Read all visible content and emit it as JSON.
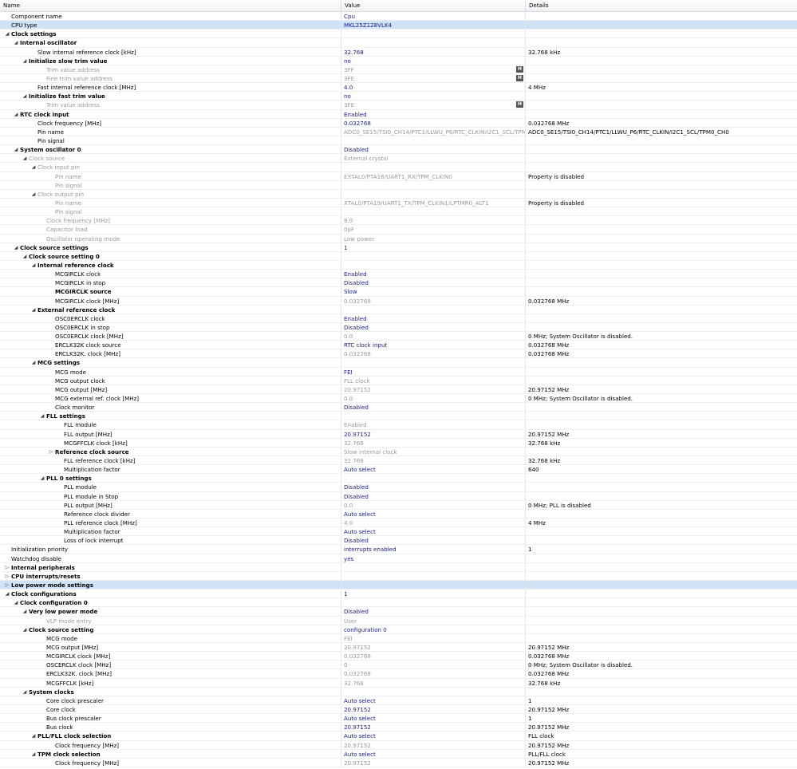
{
  "columns": {
    "name": "Name",
    "value": "Value",
    "details": "Details"
  },
  "rows": [
    {
      "name": "Component name",
      "value": "Cpu",
      "details": "",
      "indent": 0,
      "exp": "",
      "bold": false,
      "grey": false,
      "vgrey": false
    },
    {
      "name": "CPU type",
      "value": "MKL25Z128VLK4",
      "details": "",
      "indent": 0,
      "exp": "",
      "bold": false,
      "grey": false,
      "vgrey": false,
      "sel": true
    },
    {
      "name": "Clock settings",
      "value": "",
      "details": "",
      "indent": 0,
      "exp": "◢",
      "bold": true
    },
    {
      "name": "Internal oscillator",
      "value": "",
      "details": "",
      "indent": 1,
      "exp": "◢",
      "bold": true
    },
    {
      "name": "Slow internal reference clock [kHz]",
      "value": "32.768",
      "details": "32.768 kHz",
      "indent": 3
    },
    {
      "name": "Initialize slow trim value",
      "value": "no",
      "details": "",
      "indent": 2,
      "exp": "◢",
      "bold": true
    },
    {
      "name": "Trim value address",
      "value": "3FF",
      "details": "",
      "indent": 4,
      "grey": true,
      "vgrey": true,
      "h": true
    },
    {
      "name": "Fine trim value address",
      "value": "3FE",
      "details": "",
      "indent": 4,
      "grey": true,
      "vgrey": true,
      "h": true
    },
    {
      "name": "Fast internal reference clock [MHz]",
      "value": "4.0",
      "details": "4 MHz",
      "indent": 3
    },
    {
      "name": "Initialize fast trim value",
      "value": "no",
      "details": "",
      "indent": 2,
      "exp": "◢",
      "bold": true
    },
    {
      "name": "Trim value address",
      "value": "3FE",
      "details": "",
      "indent": 4,
      "grey": true,
      "vgrey": true,
      "h": true
    },
    {
      "name": "RTC clock input",
      "value": "Enabled",
      "details": "",
      "indent": 1,
      "exp": "◢",
      "bold": true
    },
    {
      "name": "Clock frequency [MHz]",
      "value": "0.032768",
      "details": "0.032768 MHz",
      "indent": 3
    },
    {
      "name": "Pin name",
      "value": "ADC0_SE15/TSI0_CH14/PTC1/LLWU_P6/RTC_CLKIN/I2C1_SCL/TPM...",
      "details": "ADC0_SE15/TSI0_CH14/PTC1/LLWU_P6/RTC_CLKIN/I2C1_SCL/TPM0_CH0",
      "indent": 3,
      "vgrey": true
    },
    {
      "name": "Pin signal",
      "value": "",
      "details": "",
      "indent": 3
    },
    {
      "name": "System oscillator 0",
      "value": "Disabled",
      "details": "",
      "indent": 1,
      "exp": "◢",
      "bold": true
    },
    {
      "name": "Clock source",
      "value": "External crystal",
      "details": "",
      "indent": 2,
      "exp": "◢",
      "grey": true,
      "vgrey": true
    },
    {
      "name": "Clock input pin",
      "value": "",
      "details": "",
      "indent": 3,
      "exp": "◢",
      "grey": true
    },
    {
      "name": "Pin name",
      "value": "EXTAL0/PTA18/UART1_RX/TPM_CLKIN0",
      "details": "Property is disabled",
      "indent": 5,
      "grey": true,
      "vgrey": true
    },
    {
      "name": "Pin signal",
      "value": "",
      "details": "",
      "indent": 5,
      "grey": true
    },
    {
      "name": "Clock output pin",
      "value": "",
      "details": "",
      "indent": 3,
      "exp": "◢",
      "grey": true
    },
    {
      "name": "Pin name",
      "value": "XTAL0/PTA19/UART1_TX/TPM_CLKIN1/LPTMR0_ALT1",
      "details": "Property is disabled",
      "indent": 5,
      "grey": true,
      "vgrey": true
    },
    {
      "name": "Pin signal",
      "value": "",
      "details": "",
      "indent": 5,
      "grey": true
    },
    {
      "name": "Clock frequency [MHz]",
      "value": "8.0",
      "details": "",
      "indent": 4,
      "grey": true,
      "vgrey": true
    },
    {
      "name": "Capacitor load",
      "value": "0pF",
      "details": "",
      "indent": 4,
      "grey": true,
      "vgrey": true
    },
    {
      "name": "Oscillator operating mode",
      "value": "Low power",
      "details": "",
      "indent": 4,
      "grey": true,
      "vgrey": true
    },
    {
      "name": "Clock source settings",
      "value": "1",
      "details": "",
      "indent": 1,
      "exp": "◢",
      "bold": true
    },
    {
      "name": "Clock source setting 0",
      "value": "",
      "details": "",
      "indent": 2,
      "exp": "◢",
      "bold": true
    },
    {
      "name": "Internal reference clock",
      "value": "",
      "details": "",
      "indent": 3,
      "exp": "◢",
      "bold": true
    },
    {
      "name": "MCGIRCLK clock",
      "value": "Enabled",
      "details": "",
      "indent": 5
    },
    {
      "name": "MCGIRCLK in stop",
      "value": "Disabled",
      "details": "",
      "indent": 5
    },
    {
      "name": "MCGIRCLK source",
      "value": "Slow",
      "details": "",
      "indent": 5,
      "bold": true
    },
    {
      "name": "MCGIRCLK clock [MHz]",
      "value": "0.032768",
      "details": "0.032768 MHz",
      "indent": 5,
      "vgrey": true
    },
    {
      "name": "External reference clock",
      "value": "",
      "details": "",
      "indent": 3,
      "exp": "◢",
      "bold": true
    },
    {
      "name": "OSC0ERCLK clock",
      "value": "Enabled",
      "details": "",
      "indent": 5
    },
    {
      "name": "OSC0ERCLK in stop",
      "value": "Disabled",
      "details": "",
      "indent": 5
    },
    {
      "name": "OSC0ERCLK clock [MHz]",
      "value": "0.0",
      "details": "0 MHz; System Oscillator is disabled.",
      "indent": 5,
      "vgrey": true
    },
    {
      "name": "ERCLK32K clock source",
      "value": "RTC clock input",
      "details": "0.032768 MHz",
      "indent": 5
    },
    {
      "name": "ERCLK32K. clock [MHz]",
      "value": "0.032768",
      "details": "0.032768 MHz",
      "indent": 5,
      "vgrey": true
    },
    {
      "name": "MCG settings",
      "value": "",
      "details": "",
      "indent": 3,
      "exp": "◢",
      "bold": true
    },
    {
      "name": "MCG mode",
      "value": "FEI",
      "details": "",
      "indent": 5
    },
    {
      "name": "MCG output clock",
      "value": "FLL clock",
      "details": "",
      "indent": 5,
      "vgrey": true
    },
    {
      "name": "MCG output [MHz]",
      "value": "20.97152",
      "details": "20.97152 MHz",
      "indent": 5,
      "vgrey": true
    },
    {
      "name": "MCG external ref. clock [MHz]",
      "value": "0.0",
      "details": "0 MHz; System Oscillator is disabled.",
      "indent": 5,
      "vgrey": true
    },
    {
      "name": "Clock monitor",
      "value": "Disabled",
      "details": "",
      "indent": 5
    },
    {
      "name": "FLL settings",
      "value": "",
      "details": "",
      "indent": 4,
      "exp": "◢",
      "bold": true
    },
    {
      "name": "FLL module",
      "value": "Enabled",
      "details": "",
      "indent": 6,
      "vgrey": true
    },
    {
      "name": "FLL output [MHz]",
      "value": "20.97152",
      "details": "20.97152 MHz",
      "indent": 6
    },
    {
      "name": "MCGFFCLK clock [kHz]",
      "value": "32.768",
      "details": "32.768 kHz",
      "indent": 6,
      "vgrey": true
    },
    {
      "name": "Reference clock source",
      "value": "Slow internal clock",
      "details": "",
      "indent": 5,
      "exp": "▷",
      "bold": true,
      "vgrey": true
    },
    {
      "name": "FLL reference clock [kHz]",
      "value": "32.768",
      "details": "32.768 kHz",
      "indent": 6,
      "vgrey": true
    },
    {
      "name": "Multiplication factor",
      "value": "Auto select",
      "details": "640",
      "indent": 6
    },
    {
      "name": "PLL 0 settings",
      "value": "",
      "details": "",
      "indent": 4,
      "exp": "◢",
      "bold": true
    },
    {
      "name": "PLL module",
      "value": "Disabled",
      "details": "",
      "indent": 6
    },
    {
      "name": "PLL module in Stop",
      "value": "Disabled",
      "details": "",
      "indent": 6
    },
    {
      "name": "PLL output [MHz]",
      "value": "0.0",
      "details": "0 MHz; PLL is disabled",
      "indent": 6,
      "vgrey": true
    },
    {
      "name": "Reference clock divider",
      "value": "Auto select",
      "details": "",
      "indent": 6
    },
    {
      "name": "PLL reference clock [MHz]",
      "value": "4.0",
      "details": "4 MHz",
      "indent": 6,
      "vgrey": true
    },
    {
      "name": "Multiplication factor",
      "value": "Auto select",
      "details": "",
      "indent": 6
    },
    {
      "name": "Loss of lock interrupt",
      "value": "Disabled",
      "details": "",
      "indent": 6
    },
    {
      "name": "Initialization priority",
      "value": "interrupts enabled",
      "details": "1",
      "indent": 0
    },
    {
      "name": "Watchdog disable",
      "value": "yes",
      "details": "",
      "indent": 0
    },
    {
      "name": "Internal peripherals",
      "value": "",
      "details": "",
      "indent": 0,
      "exp": "▷",
      "bold": true
    },
    {
      "name": "CPU interrupts/resets",
      "value": "",
      "details": "",
      "indent": 0,
      "exp": "▷",
      "bold": true
    },
    {
      "name": "Low power mode settings",
      "value": "",
      "details": "",
      "indent": 0,
      "exp": "▷",
      "bold": true,
      "sel": true
    },
    {
      "name": "Clock configurations",
      "value": "1",
      "details": "",
      "indent": 0,
      "exp": "◢",
      "bold": true
    },
    {
      "name": "Clock configuration 0",
      "value": "",
      "details": "",
      "indent": 1,
      "exp": "◢",
      "bold": true
    },
    {
      "name": "Very low power mode",
      "value": "Disabled",
      "details": "",
      "indent": 2,
      "exp": "◢",
      "bold": true
    },
    {
      "name": "VLP mode entry",
      "value": "User",
      "details": "",
      "indent": 4,
      "grey": true,
      "vgrey": true
    },
    {
      "name": "Clock source setting",
      "value": "configuration 0",
      "details": "",
      "indent": 2,
      "exp": "◢",
      "bold": true
    },
    {
      "name": "MCG mode",
      "value": "FEI",
      "details": "",
      "indent": 4,
      "vgrey": true
    },
    {
      "name": "MCG output [MHz]",
      "value": "20.97152",
      "details": "20.97152 MHz",
      "indent": 4,
      "vgrey": true
    },
    {
      "name": "MCGIRCLK clock [MHz]",
      "value": "0.032768",
      "details": "0.032768 MHz",
      "indent": 4,
      "vgrey": true
    },
    {
      "name": "OSCERCLK clock [MHz]",
      "value": "0",
      "details": "0 MHz; System Oscillator is disabled.",
      "indent": 4,
      "vgrey": true
    },
    {
      "name": "ERCLK32K. clock [MHz]",
      "value": "0.032768",
      "details": "0.032768 MHz",
      "indent": 4,
      "vgrey": true
    },
    {
      "name": "MCGFFCLK [kHz]",
      "value": "32.768",
      "details": "32.768 kHz",
      "indent": 4,
      "vgrey": true
    },
    {
      "name": "System clocks",
      "value": "",
      "details": "",
      "indent": 2,
      "exp": "◢",
      "bold": true
    },
    {
      "name": "Core clock prescaler",
      "value": "Auto select",
      "details": "1",
      "indent": 4
    },
    {
      "name": "Core clock",
      "value": "20.97152",
      "details": "20.97152 MHz",
      "indent": 4
    },
    {
      "name": "Bus clock prescaler",
      "value": "Auto select",
      "details": "1",
      "indent": 4
    },
    {
      "name": "Bus clock",
      "value": "20.97152",
      "details": "20.97152 MHz",
      "indent": 4
    },
    {
      "name": "PLL/FLL clock selection",
      "value": "Auto select",
      "details": "FLL clock",
      "indent": 3,
      "exp": "◢",
      "bold": true
    },
    {
      "name": "Clock frequency [MHz]",
      "value": "20.97152",
      "details": "20.97152 MHz",
      "indent": 5,
      "vgrey": true
    },
    {
      "name": "TPM clock selection",
      "value": "Auto select",
      "details": "PLL/FLL clock",
      "indent": 3,
      "exp": "◢",
      "bold": true
    },
    {
      "name": "Clock frequency [MHz]",
      "value": "20.97152",
      "details": "20.97152 MHz",
      "indent": 5,
      "vgrey": true
    }
  ]
}
